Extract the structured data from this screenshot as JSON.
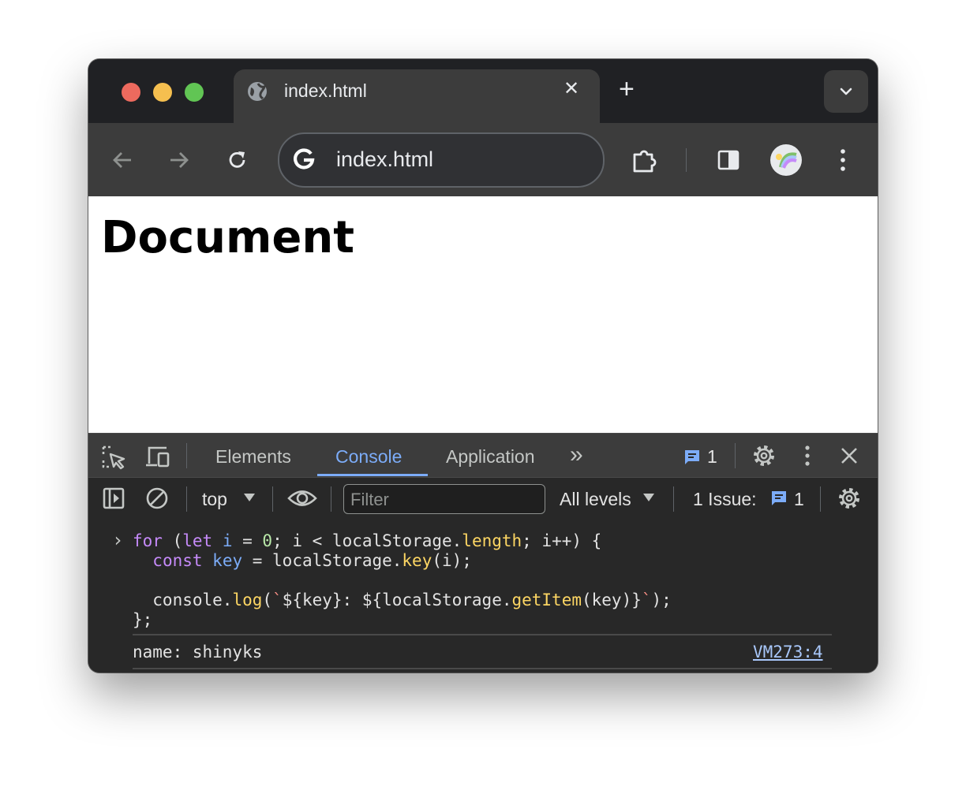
{
  "browser": {
    "tab_title": "index.html",
    "close_tab": "✕",
    "new_tab": "+",
    "address": "index.html"
  },
  "page": {
    "heading": "Document"
  },
  "devtools": {
    "tabs": [
      "Elements",
      "Console",
      "Application"
    ],
    "active_tab": "Console",
    "more_tabs": "»",
    "issues_count": "1",
    "context": "top",
    "filter_placeholder": "Filter",
    "levels": "All levels",
    "issues_label": "1 Issue:",
    "issues_badge": "1"
  },
  "console": {
    "prompt": "›",
    "code_lines": [
      "for (let i = 0; i < localStorage.length; i++) {",
      "  const key = localStorage.key(i);",
      "",
      "  console.log(`${key}: ${localStorage.getItem(key)}`);",
      "};"
    ],
    "output": "name: shinyks",
    "source_link": "VM273:4"
  },
  "colors": {
    "accent": "#7cacf8",
    "close_light": "#ed6a5e",
    "minimize_light": "#f5bf4f",
    "maximize_light": "#61c554"
  }
}
